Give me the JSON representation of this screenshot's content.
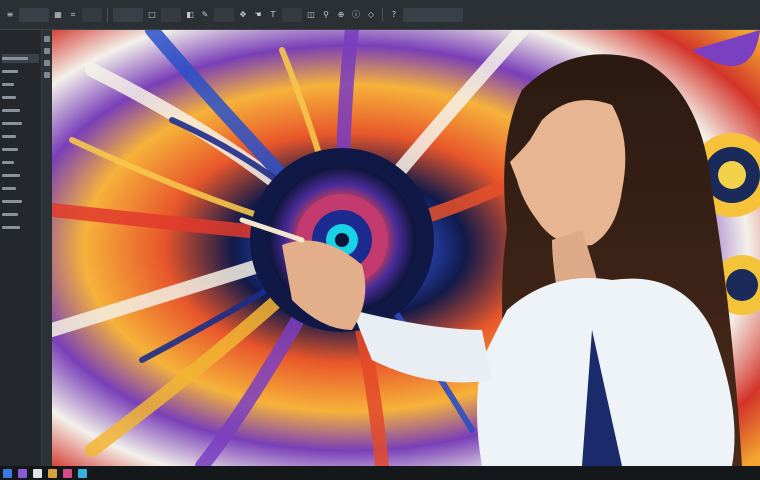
{
  "toolbar": {
    "buttons": [
      "file-menu",
      "edit-menu",
      "image-menu",
      "layer-menu",
      "select-menu",
      "filter-menu",
      "view-menu",
      "window-menu"
    ]
  },
  "colors": {
    "chrome": "#2b3035",
    "panel": "#24282d",
    "accent": "#3a4047",
    "canvas_warm": "#f6a52a",
    "canvas_blue": "#1f3f9e",
    "canvas_red": "#d8392b",
    "shirt": "#eef3f8",
    "hair": "#2a1a14"
  },
  "taskbar": {
    "icons": [
      "start-icon",
      "browser-icon",
      "media-icon",
      "files-icon",
      "app-icon"
    ]
  }
}
